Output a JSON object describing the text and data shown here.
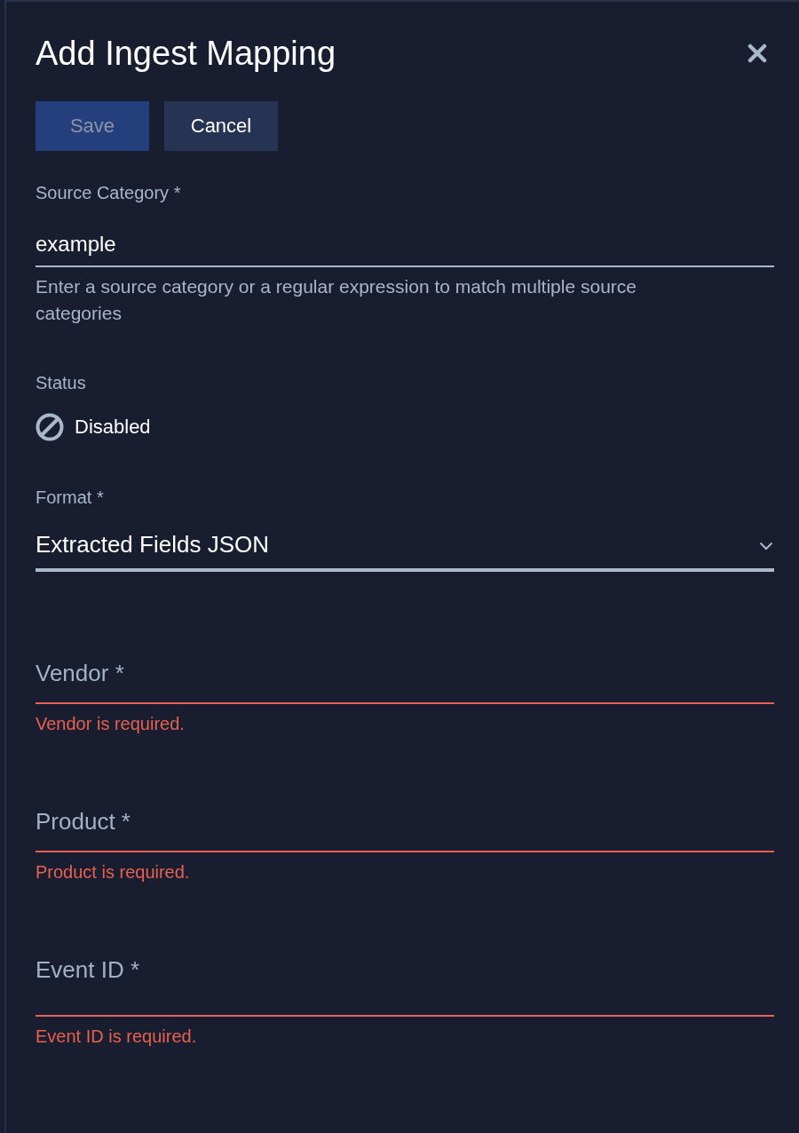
{
  "dialog": {
    "title": "Add Ingest Mapping"
  },
  "buttons": [
    {
      "label": "Save",
      "kind": "primary",
      "disabled": true
    },
    {
      "label": "Cancel",
      "kind": "secondary",
      "disabled": false
    }
  ],
  "source_category": {
    "label": "Source Category *",
    "value": "example",
    "help": "Enter a source category or a regular expression to match multiple source categories"
  },
  "status": {
    "label": "Status",
    "value": "Disabled",
    "enabled": false
  },
  "format": {
    "label": "Format *",
    "value": "Extracted Fields JSON"
  },
  "required_fields": [
    {
      "placeholder": "Vendor *",
      "invalid": true,
      "error": "Vendor is required."
    },
    {
      "placeholder": "Product *",
      "invalid": true,
      "error": "Product is required."
    },
    {
      "placeholder": "Event ID *",
      "invalid": true,
      "error": "Event ID is required."
    }
  ]
}
